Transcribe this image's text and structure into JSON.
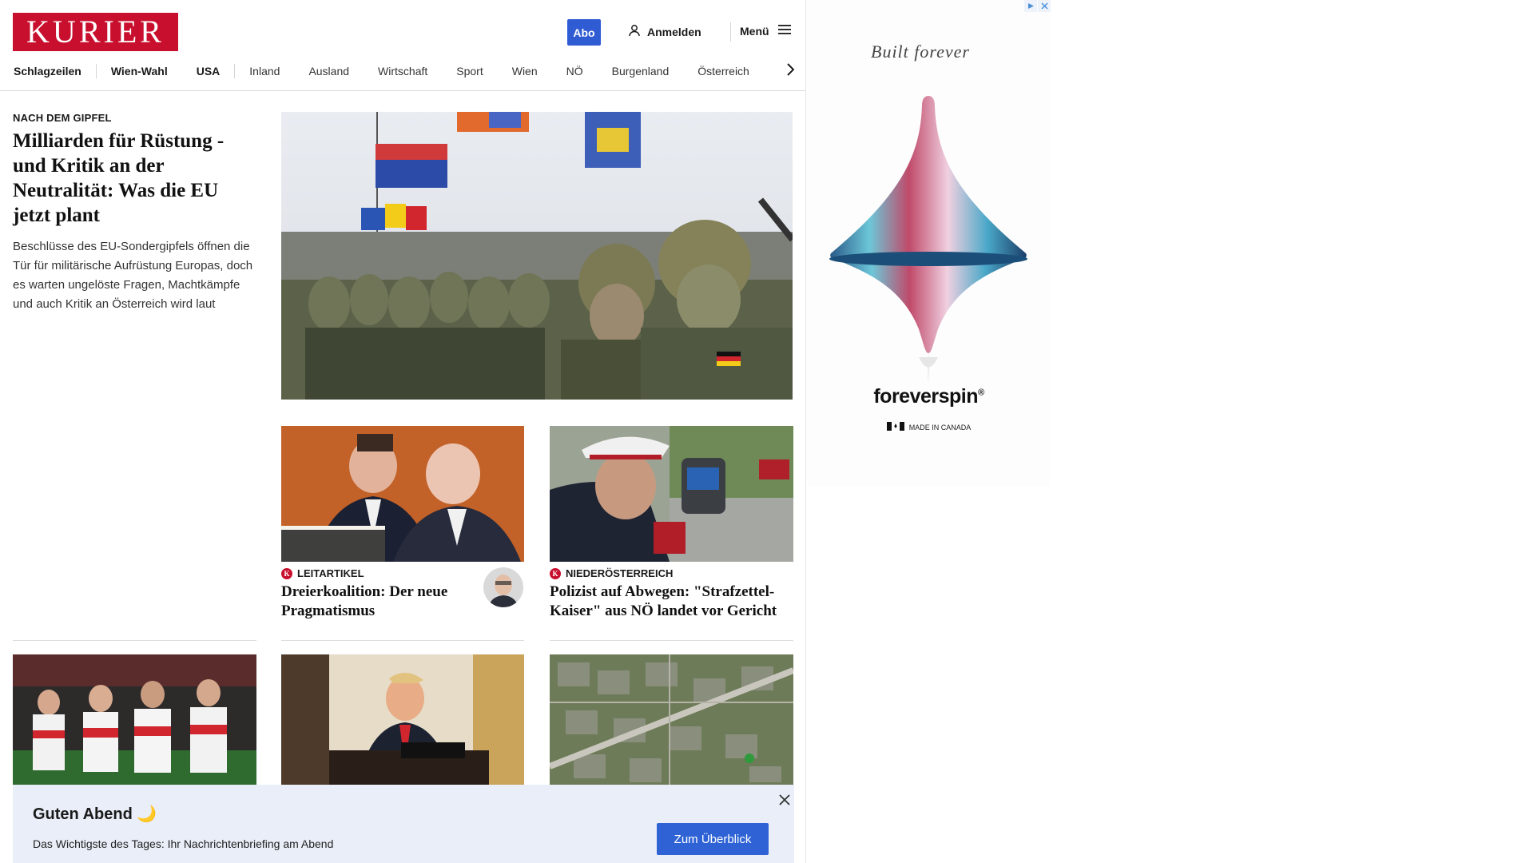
{
  "header": {
    "logo_text": "KURIER",
    "abo_label": "Abo",
    "login_label": "Anmelden",
    "menu_label": "Menü"
  },
  "nav": {
    "items": [
      "Schlagzeilen",
      "Wien-Wahl",
      "USA",
      "Inland",
      "Ausland",
      "Wirtschaft",
      "Sport",
      "Wien",
      "NÖ",
      "Burgenland",
      "Österreich"
    ]
  },
  "lead": {
    "kicker": "NACH DEM GIPFEL",
    "title": "Milliarden für Rüstung - und Kritik an der Neutralität: Was die EU jetzt plant",
    "description": "Beschlüsse des EU-Sondergipfels öffnen die Tür für militärische Aufrüstung Europas, doch es warten ungelöste Fragen, Machtkämpfe und auch Kritik an Österreich wird laut"
  },
  "cards": [
    {
      "kicker": "LEITARTIKEL",
      "title": "Dreierkoalition: Der neue Pragmatismus"
    },
    {
      "kicker": "NIEDERÖSTERREICH",
      "title": "Polizist auf Abwegen: \"Strafzettel-Kaiser\" aus NÖ landet vor Gericht"
    }
  ],
  "briefing": {
    "title": "Guten Abend 🌙",
    "text": "Das Wichtigste des Tages: Ihr Nachrichtenbriefing am Abend",
    "button_label": "Zum Überblick"
  },
  "ad": {
    "script_text": "Built forever",
    "brand": "foreverspin",
    "brand_mark": "®",
    "made_in": "MADE IN CANADA"
  },
  "colors": {
    "brand_red": "#c8102e",
    "accent_blue": "#2f5bd3",
    "briefing_bg": "#e9eef8"
  }
}
